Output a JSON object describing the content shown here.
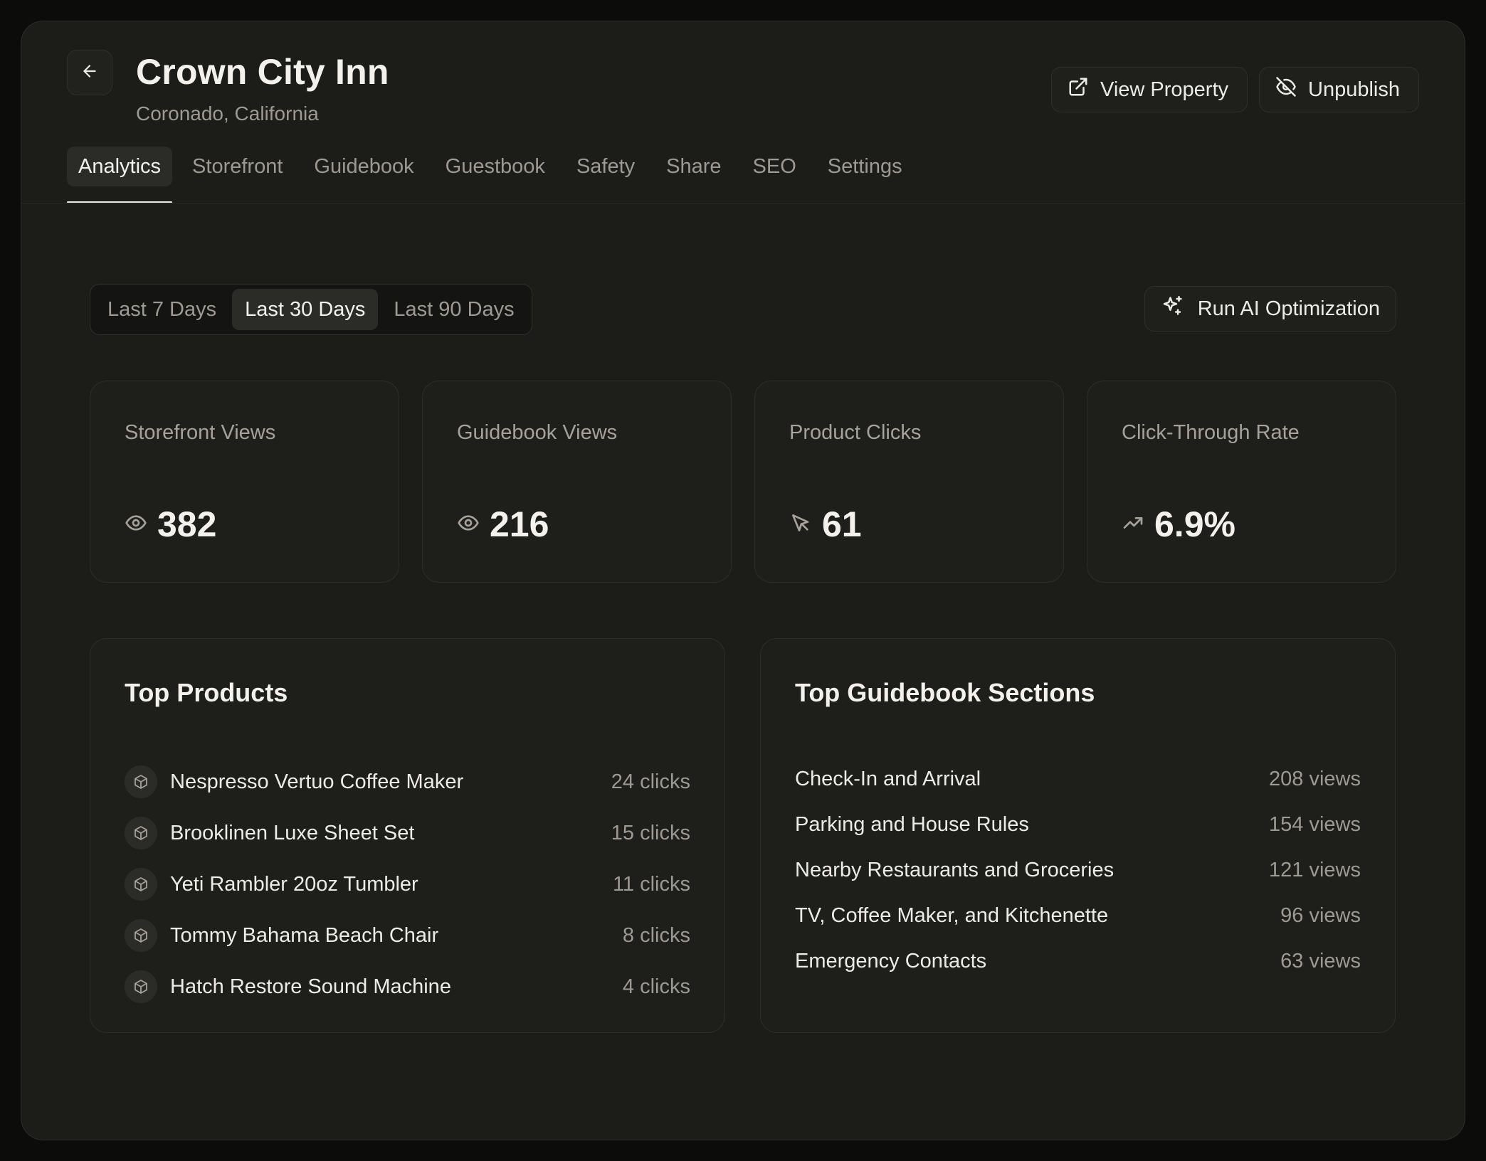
{
  "header": {
    "title": "Crown City Inn",
    "subtitle": "Coronado, California",
    "actions": {
      "view_property": "View Property",
      "unpublish": "Unpublish"
    }
  },
  "tabs": [
    {
      "label": "Analytics",
      "active": true
    },
    {
      "label": "Storefront"
    },
    {
      "label": "Guidebook"
    },
    {
      "label": "Guestbook"
    },
    {
      "label": "Safety"
    },
    {
      "label": "Share"
    },
    {
      "label": "SEO"
    },
    {
      "label": "Settings"
    }
  ],
  "range": {
    "options": [
      "Last 7 Days",
      "Last 30 Days",
      "Last 90 Days"
    ],
    "selected": "Last 30 Days"
  },
  "ai_button": "Run AI Optimization",
  "stats": [
    {
      "label": "Storefront Views",
      "value": "382",
      "icon": "eye-icon"
    },
    {
      "label": "Guidebook Views",
      "value": "216",
      "icon": "eye-icon"
    },
    {
      "label": "Product Clicks",
      "value": "61",
      "icon": "cursor-click-icon"
    },
    {
      "label": "Click-Through Rate",
      "value": "6.9%",
      "icon": "trending-up-icon"
    }
  ],
  "top_products": {
    "title": "Top Products",
    "items": [
      {
        "name": "Nespresso Vertuo Coffee Maker",
        "count": "24 clicks"
      },
      {
        "name": "Brooklinen Luxe Sheet Set",
        "count": "15 clicks"
      },
      {
        "name": "Yeti Rambler 20oz Tumbler",
        "count": "11 clicks"
      },
      {
        "name": "Tommy Bahama Beach Chair",
        "count": "8 clicks"
      },
      {
        "name": "Hatch Restore Sound Machine",
        "count": "4 clicks"
      }
    ]
  },
  "top_sections": {
    "title": "Top Guidebook Sections",
    "items": [
      {
        "name": "Check-In and Arrival",
        "count": "208 views"
      },
      {
        "name": "Parking and House Rules",
        "count": "154 views"
      },
      {
        "name": "Nearby Restaurants and Groceries",
        "count": "121 views"
      },
      {
        "name": "TV, Coffee Maker, and Kitchenette",
        "count": "96 views"
      },
      {
        "name": "Emergency Contacts",
        "count": "63 views"
      }
    ]
  },
  "colors": {
    "background": "#0c0c0b",
    "panel": "#1c1c19",
    "card": "#1e1e1b",
    "text": "#ecebe6",
    "muted": "#9c9a92",
    "active_tab": "#2b2b27"
  }
}
